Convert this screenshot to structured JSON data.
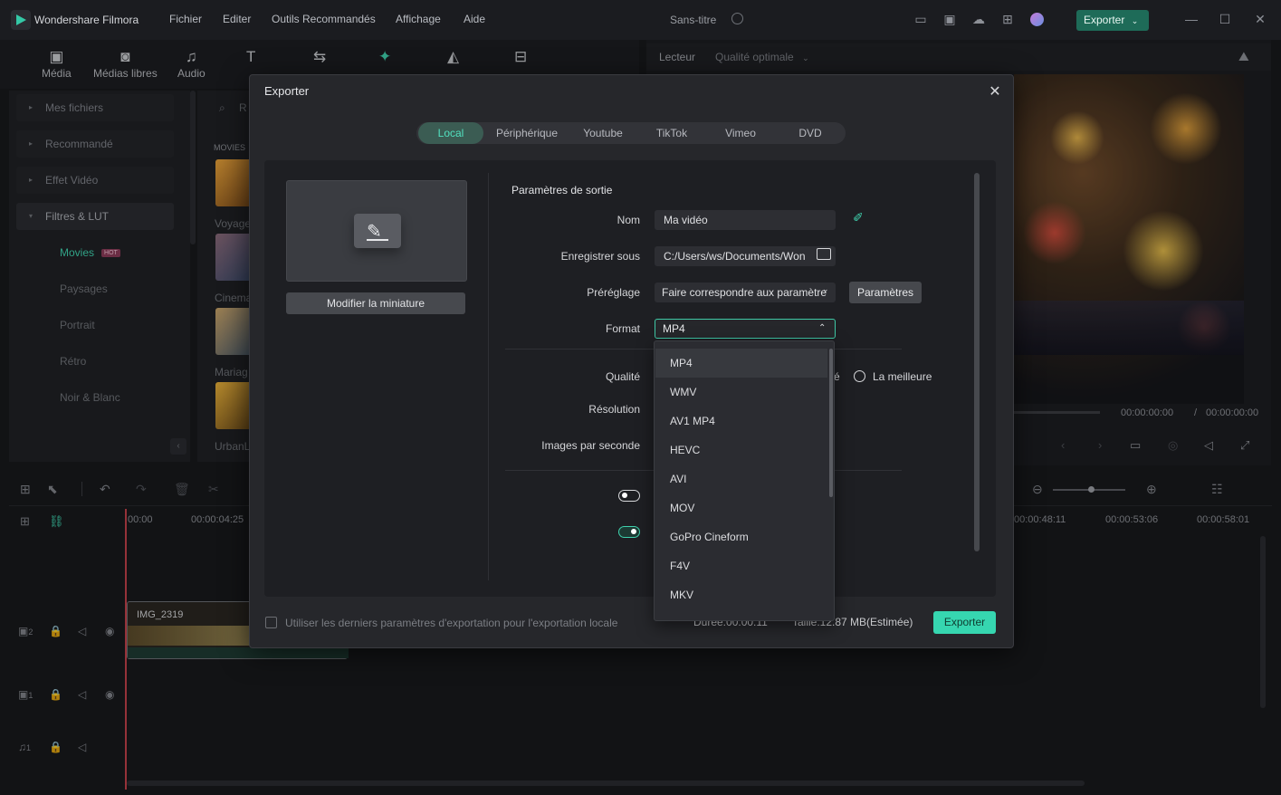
{
  "app": {
    "title": "Wondershare Filmora",
    "project_title": "Sans-titre"
  },
  "menu": [
    "Fichier",
    "Editer",
    "Outils Recommandés",
    "Affichage",
    "Aide"
  ],
  "top_export": "Exporter",
  "toolbar": {
    "media": "Média",
    "free_media": "Médias libres",
    "audio": "Audio",
    "titles": "Titres",
    "transitions": "Transitions",
    "effects": "Effets",
    "animations": "Autocollants",
    "templates": "Modèles"
  },
  "player": {
    "label": "Lecteur",
    "quality": "Qualité optimale",
    "time_current": "00:00:00:00",
    "time_sep": "/",
    "time_total": "00:00:00:00"
  },
  "sidebar": {
    "items": [
      "Mes fichiers",
      "Recommandé",
      "Effet Vidéo",
      "Filtres & LUT"
    ],
    "sub_items": [
      "Movies",
      "Paysages",
      "Portrait",
      "Rétro",
      "Noir & Blanc"
    ],
    "hot_badge": "HOT",
    "section": "MOVIES",
    "search_prefix": "R"
  },
  "thumbs": [
    "Voyage",
    "Cinema",
    "Mariag",
    "UrbanL"
  ],
  "timeline": {
    "ticks_left": [
      "00:00",
      "00:00:04:25"
    ],
    "ticks_right": [
      "00:00:48:11",
      "00:00:53:06",
      "00:00:58:01"
    ],
    "clip_name": "IMG_2319",
    "track_labels": [
      "2",
      "1",
      "1"
    ]
  },
  "dialog": {
    "title": "Exporter",
    "tabs": [
      "Local",
      "Périphérique",
      "Youtube",
      "TikTok",
      "Vimeo",
      "DVD"
    ],
    "active_tab": "Local",
    "thumbnail_button": "Modifier la miniature",
    "section_title": "Paramètres de sortie",
    "labels": {
      "name": "Nom",
      "save_to": "Enregistrer sous",
      "preset": "Préréglage",
      "format": "Format",
      "quality": "Qualité",
      "resolution": "Résolution",
      "fps": "Images par seconde"
    },
    "values": {
      "name": "Ma vidéo",
      "save_to": "C:/Users/ws/Documents/Won",
      "preset": "Faire correspondre aux paramètre",
      "format": "MP4"
    },
    "settings_button": "Paramètres",
    "quality_option_partial": "é",
    "quality_best": "La meilleure",
    "footer": {
      "checkbox_label": "Utiliser les derniers paramètres d'exportation pour l'exportation locale",
      "duration": "Durée:00:00:11",
      "size": "Taille:12.87 MB(Estimée)",
      "export": "Exporter"
    }
  },
  "format_options": [
    "MP4",
    "WMV",
    "AV1 MP4",
    "HEVC",
    "AVI",
    "MOV",
    "GoPro Cineform",
    "F4V",
    "MKV"
  ],
  "colors": {
    "accent": "#36d6b0",
    "dark_accent": "#1e6b58",
    "bg": "#18191c"
  }
}
